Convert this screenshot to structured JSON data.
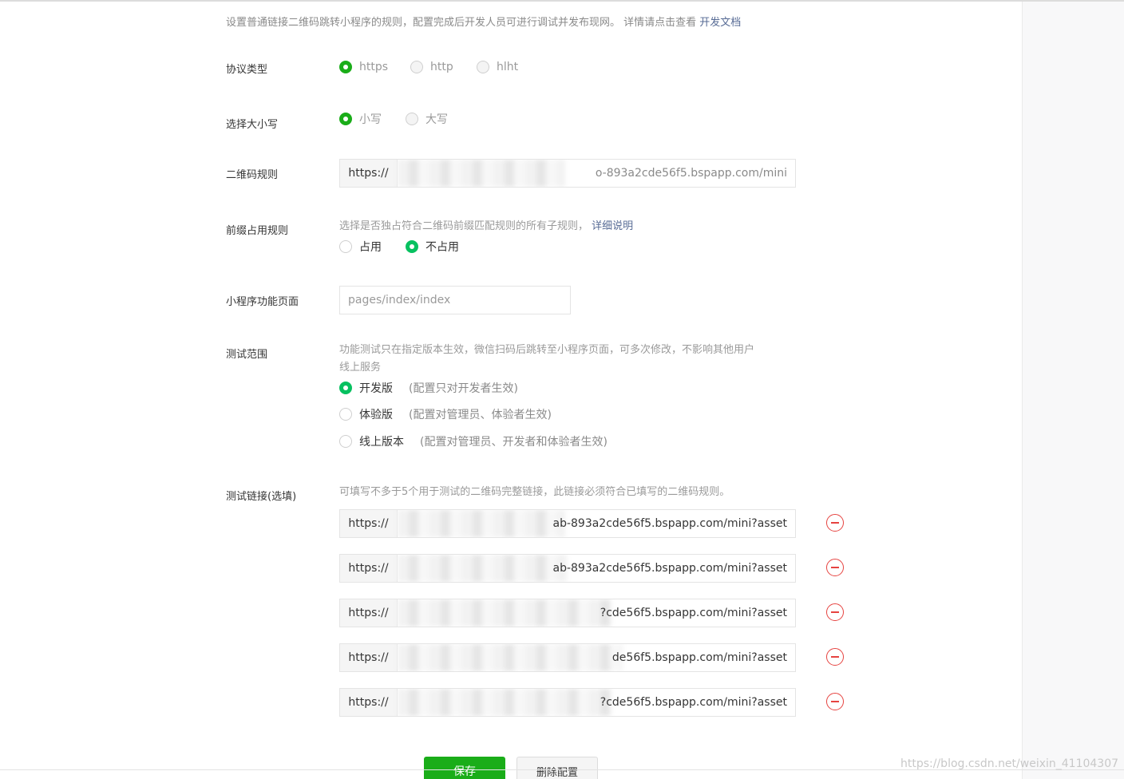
{
  "intro": {
    "text": "设置普通链接二维码跳转小程序的规则，配置完成后开发人员可进行调试并发布现网。 详情请点击查看",
    "link": "开发文档"
  },
  "protocol": {
    "label": "协议类型",
    "options": [
      {
        "label": "https",
        "selected": true
      },
      {
        "label": "http",
        "selected": false
      },
      {
        "label": "hlht",
        "selected": false
      }
    ]
  },
  "case": {
    "label": "选择大小写",
    "options": [
      {
        "label": "小写",
        "selected": true
      },
      {
        "label": "大写",
        "selected": false
      }
    ]
  },
  "qr_rule": {
    "label": "二维码规则",
    "prefix": "https://",
    "value_tail": "o-893a2cde56f5.bspapp.com/mini"
  },
  "prefix_rule": {
    "label": "前缀占用规则",
    "hint": "选择是否独占符合二维码前缀匹配规则的所有子规则，",
    "link": "详细说明",
    "options": [
      {
        "label": "占用",
        "selected": false
      },
      {
        "label": "不占用",
        "selected": true
      }
    ]
  },
  "page": {
    "label": "小程序功能页面",
    "placeholder": "pages/index/index"
  },
  "scope": {
    "label": "测试范围",
    "hint_line1": "功能测试只在指定版本生效，微信扫码后跳转至小程序页面，可多次修改，不影响其他用户",
    "hint_line2": "线上服务",
    "options": [
      {
        "label": "开发版",
        "note": "(配置只对开发者生效)",
        "selected": true
      },
      {
        "label": "体验版",
        "note": "(配置对管理员、体验者生效)",
        "selected": false
      },
      {
        "label": "线上版本",
        "note": "(配置对管理员、开发者和体验者生效)",
        "selected": false
      }
    ]
  },
  "test_links": {
    "label": "测试链接(选填)",
    "hint": "可填写不多于5个用于测试的二维码完整链接，此链接必须符合已填写的二维码规则。",
    "prefix": "https://",
    "items": [
      {
        "tail": "ab-893a2cde56f5.bspapp.com/mini?asset"
      },
      {
        "tail": "ab-893a2cde56f5.bspapp.com/mini?asset"
      },
      {
        "tail": "?cde56f5.bspapp.com/mini?asset"
      },
      {
        "tail": "de56f5.bspapp.com/mini?asset"
      },
      {
        "tail": "?cde56f5.bspapp.com/mini?asset"
      }
    ]
  },
  "actions": {
    "save": "保存",
    "delete": "删除配置"
  },
  "watermark": "https://blog.csdn.net/weixin_41104307"
}
